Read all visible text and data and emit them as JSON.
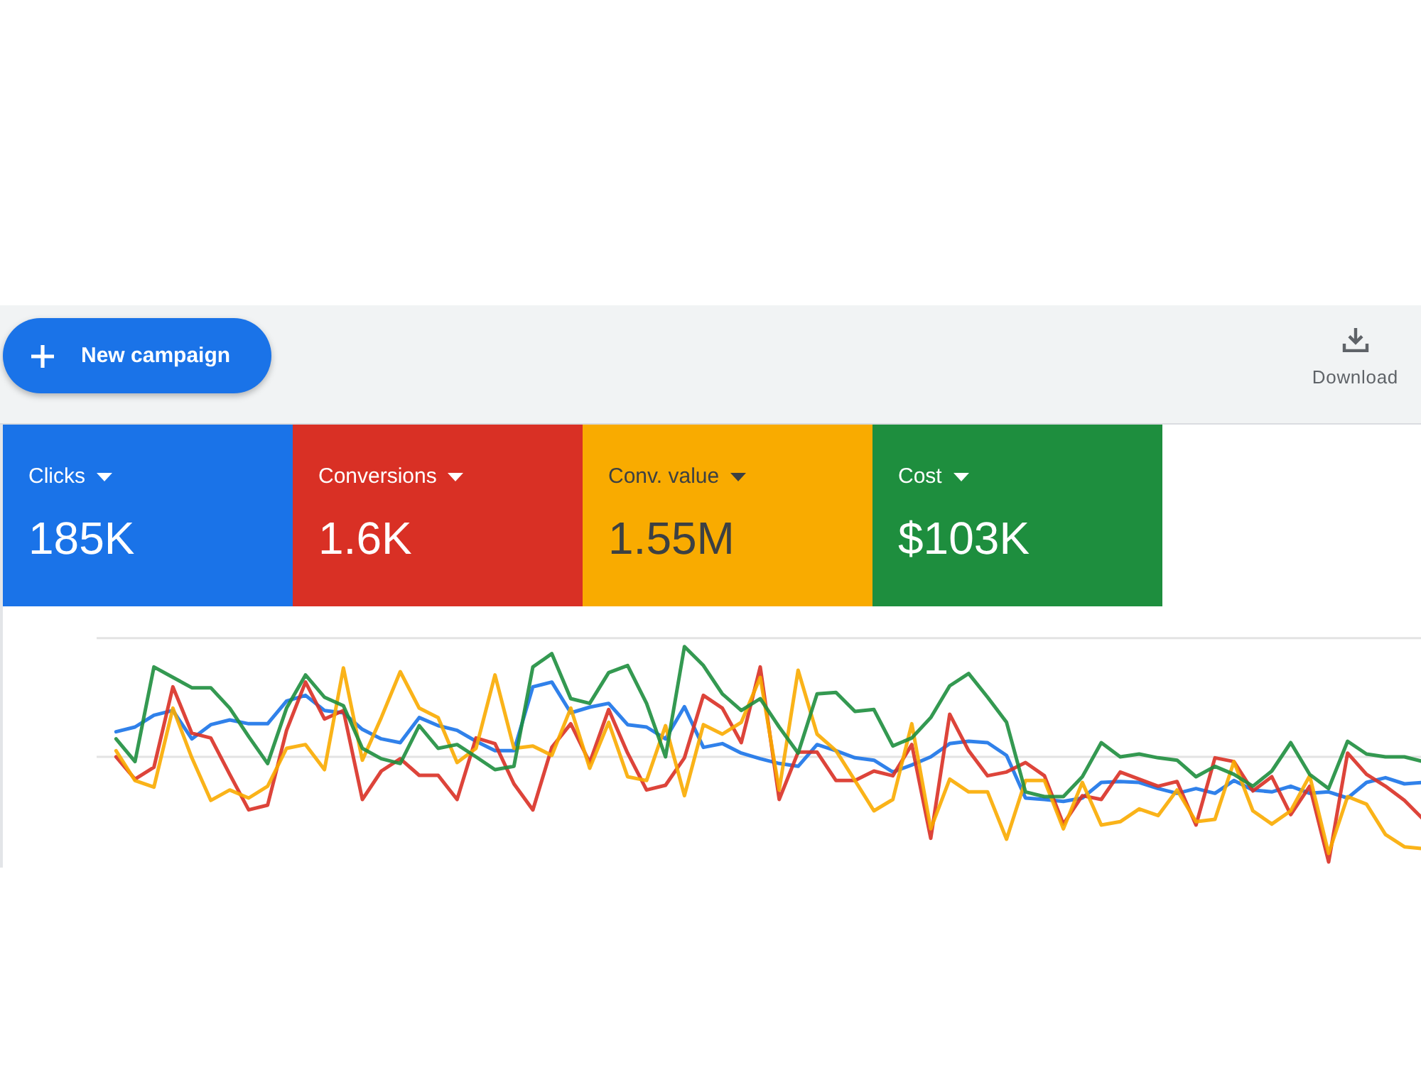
{
  "toolbar": {
    "new_campaign_button": {
      "label": "New campaign"
    },
    "download_button": {
      "label": "Download"
    }
  },
  "metrics": [
    {
      "label": "Clicks",
      "value": "185K",
      "color": "#1a73e8"
    },
    {
      "label": "Conversions",
      "value": "1.6K",
      "color": "#d93025"
    },
    {
      "label": "Conv. value",
      "value": "1.55M",
      "color": "#f9ab00"
    },
    {
      "label": "Cost",
      "value": "$103K",
      "color": "#1e8e3e"
    }
  ]
}
